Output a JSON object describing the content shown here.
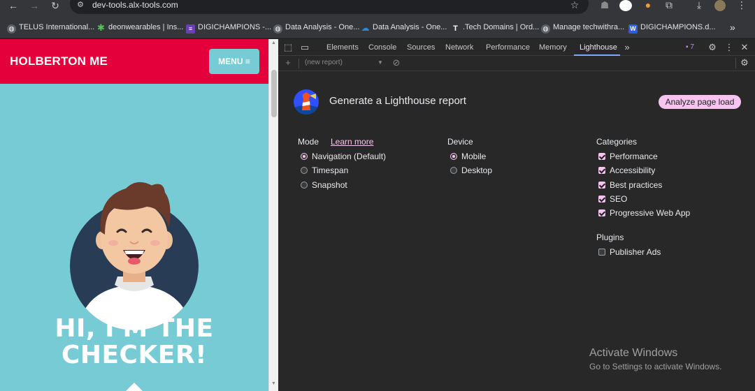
{
  "browser": {
    "url": "dev-tools.alx-tools.com",
    "bookmarks": [
      {
        "label": "TELUS International...",
        "icon": "globe-icon"
      },
      {
        "label": "deonwearables | Ins...",
        "icon": "flower-icon"
      },
      {
        "label": "DIGICHAMPIONS -...",
        "icon": "forms-icon"
      },
      {
        "label": "Data Analysis - One...",
        "icon": "globe-icon"
      },
      {
        "label": "Data Analysis - One...",
        "icon": "onedrive-icon"
      },
      {
        "label": ".Tech Domains | Ord...",
        "icon": "tech-icon"
      },
      {
        "label": "Manage techwithra...",
        "icon": "globe-icon"
      },
      {
        "label": "DIGICHAMPIONS.d...",
        "icon": "word-icon"
      }
    ],
    "bookmark_overflow": "»"
  },
  "site": {
    "title": "HOLBERTON ME",
    "menu_label": "MENU ≡",
    "hero_line1": "HI, I'M THE",
    "hero_line2": "CHECKER!"
  },
  "devtools": {
    "tabs": [
      "Elements",
      "Console",
      "Sources",
      "Network",
      "Performance",
      "Memory",
      "Lighthouse"
    ],
    "active_tab": "Lighthouse",
    "issues_count": "7",
    "report_select": "(new report)",
    "title": "Generate a Lighthouse report",
    "analyze_button": "Analyze page load",
    "mode": {
      "label": "Mode",
      "learn_more": "Learn more",
      "options": [
        {
          "label": "Navigation (Default)",
          "selected": true
        },
        {
          "label": "Timespan",
          "selected": false
        },
        {
          "label": "Snapshot",
          "selected": false
        }
      ]
    },
    "device": {
      "label": "Device",
      "options": [
        {
          "label": "Mobile",
          "selected": true
        },
        {
          "label": "Desktop",
          "selected": false
        }
      ]
    },
    "categories": {
      "label": "Categories",
      "items": [
        {
          "label": "Performance",
          "checked": true
        },
        {
          "label": "Accessibility",
          "checked": true
        },
        {
          "label": "Best practices",
          "checked": true
        },
        {
          "label": "SEO",
          "checked": true
        },
        {
          "label": "Progressive Web App",
          "checked": true
        }
      ]
    },
    "plugins": {
      "label": "Plugins",
      "items": [
        {
          "label": "Publisher Ads",
          "checked": false
        }
      ]
    }
  },
  "windows": {
    "activate_title": "Activate Windows",
    "activate_sub": "Go to Settings to activate Windows."
  },
  "colors": {
    "header_red": "#e4003a",
    "page_teal": "#76cbd4",
    "accent_pink": "#f7c4ef",
    "devtools_bg": "#282828"
  }
}
